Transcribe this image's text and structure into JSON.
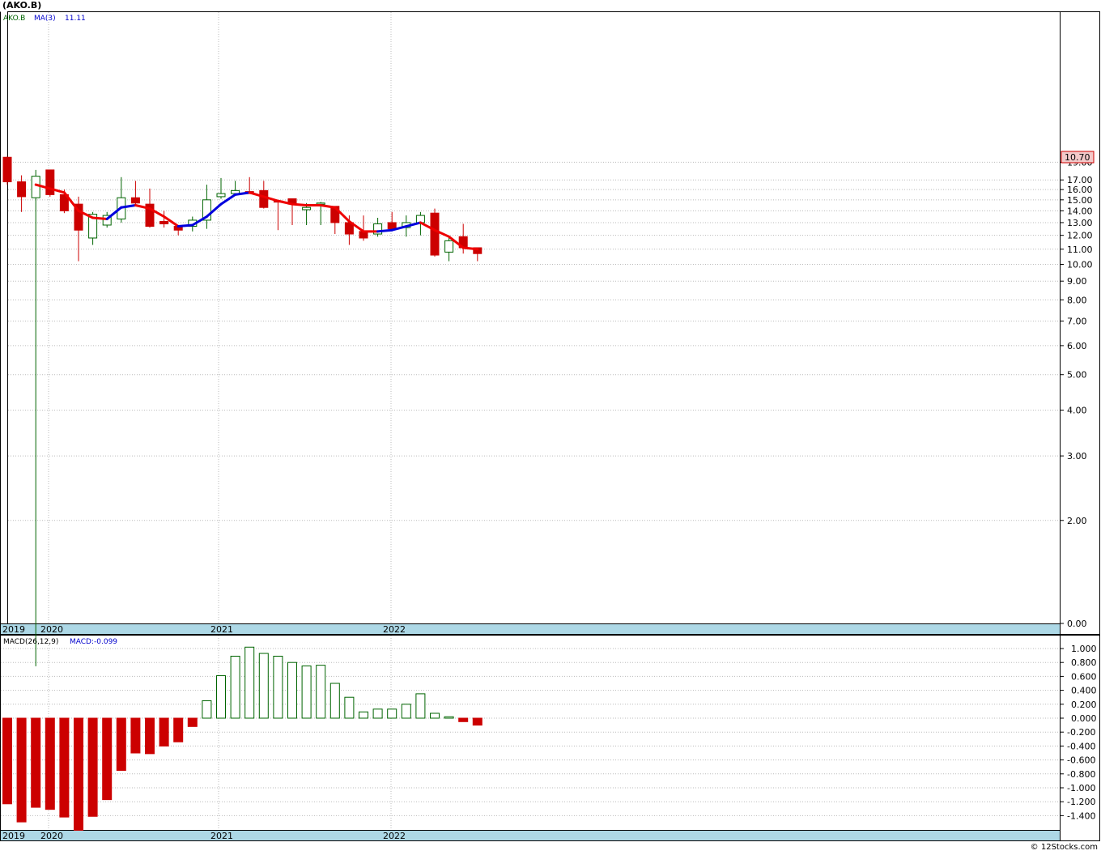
{
  "title": "(AKO.B)",
  "credit": "© 12Stocks.com",
  "chart_data": [
    {
      "type": "candlestick",
      "panel": "price",
      "legend": {
        "symbol": "AKO.B",
        "ma_label": "MA(3)",
        "ma_value": "11.11"
      },
      "last_price_label": "10.70",
      "y_scale": "log",
      "y_ticks": [
        "19.00",
        "17.00",
        "16.00",
        "15.00",
        "14.00",
        "13.00",
        "12.00",
        "11.00",
        "10.00",
        "9.00",
        "8.00",
        "7.00",
        "6.00",
        "5.00",
        "4.00",
        "3.00",
        "2.00",
        "0.00"
      ],
      "year_labels": [
        "2019",
        "2020",
        "2021",
        "2022"
      ],
      "colors": {
        "up": "#006400",
        "down": "#cc0000",
        "ma_rising": "#0000dd",
        "ma_falling": "#ee0000",
        "band": "#add8e6"
      },
      "candles": [
        {
          "o": 19.6,
          "h": 19.7,
          "l": 16.5,
          "c": 16.8
        },
        {
          "o": 16.8,
          "h": 17.5,
          "l": 13.9,
          "c": 15.3
        },
        {
          "o": 15.2,
          "h": 18.1,
          "l": 0.1,
          "c": 17.4
        },
        {
          "o": 18.1,
          "h": 18.1,
          "l": 15.3,
          "c": 15.5
        },
        {
          "o": 15.5,
          "h": 16.0,
          "l": 13.8,
          "c": 14.0
        },
        {
          "o": 14.6,
          "h": 15.3,
          "l": 10.2,
          "c": 12.4
        },
        {
          "o": 11.8,
          "h": 13.9,
          "l": 11.3,
          "c": 13.7
        },
        {
          "o": 12.8,
          "h": 13.9,
          "l": 12.6,
          "c": 13.6
        },
        {
          "o": 13.3,
          "h": 17.3,
          "l": 13.0,
          "c": 15.2
        },
        {
          "o": 15.2,
          "h": 16.9,
          "l": 14.4,
          "c": 14.7
        },
        {
          "o": 14.6,
          "h": 16.1,
          "l": 12.6,
          "c": 12.7
        },
        {
          "o": 13.1,
          "h": 14.0,
          "l": 12.6,
          "c": 12.9
        },
        {
          "o": 12.7,
          "h": 12.8,
          "l": 12.0,
          "c": 12.4
        },
        {
          "o": 12.7,
          "h": 13.5,
          "l": 12.3,
          "c": 13.2
        },
        {
          "o": 13.2,
          "h": 16.5,
          "l": 12.5,
          "c": 15.0
        },
        {
          "o": 15.3,
          "h": 17.2,
          "l": 15.1,
          "c": 15.6
        },
        {
          "o": 15.6,
          "h": 16.9,
          "l": 15.6,
          "c": 15.9
        },
        {
          "o": 15.8,
          "h": 17.3,
          "l": 15.6,
          "c": 15.6
        },
        {
          "o": 15.9,
          "h": 16.9,
          "l": 14.2,
          "c": 14.3
        },
        {
          "o": 14.9,
          "h": 15.0,
          "l": 12.4,
          "c": 14.8
        },
        {
          "o": 15.1,
          "h": 15.1,
          "l": 12.8,
          "c": 14.6
        },
        {
          "o": 14.1,
          "h": 14.7,
          "l": 12.8,
          "c": 14.3
        },
        {
          "o": 14.6,
          "h": 14.8,
          "l": 12.8,
          "c": 14.7
        },
        {
          "o": 14.4,
          "h": 14.4,
          "l": 12.1,
          "c": 13.0
        },
        {
          "o": 13.0,
          "h": 13.6,
          "l": 11.3,
          "c": 12.1
        },
        {
          "o": 12.3,
          "h": 13.6,
          "l": 11.6,
          "c": 11.8
        },
        {
          "o": 12.1,
          "h": 13.4,
          "l": 11.9,
          "c": 12.9
        },
        {
          "o": 13.0,
          "h": 13.9,
          "l": 12.6,
          "c": 12.5
        },
        {
          "o": 12.6,
          "h": 13.6,
          "l": 11.9,
          "c": 13.0
        },
        {
          "o": 13.0,
          "h": 13.9,
          "l": 12.0,
          "c": 13.6
        },
        {
          "o": 13.8,
          "h": 14.2,
          "l": 10.5,
          "c": 10.6
        },
        {
          "o": 10.8,
          "h": 11.9,
          "l": 10.2,
          "c": 11.6
        },
        {
          "o": 11.9,
          "h": 12.9,
          "l": 10.7,
          "c": 11.1
        },
        {
          "o": 11.1,
          "h": 11.1,
          "l": 10.2,
          "c": 10.7
        }
      ],
      "ma": [
        null,
        null,
        16.5,
        16.1,
        15.7,
        14.0,
        13.4,
        13.3,
        14.3,
        14.5,
        14.2,
        13.5,
        12.7,
        12.8,
        13.5,
        14.6,
        15.5,
        15.7,
        15.3,
        14.9,
        14.6,
        14.5,
        14.5,
        14.3,
        13.1,
        12.3,
        12.3,
        12.4,
        12.7,
        13.0,
        12.4,
        11.9,
        11.1,
        11.0
      ]
    },
    {
      "type": "bar",
      "panel": "macd",
      "legend": {
        "label": "MACD(26,12,9)",
        "value_label": "MACD:-0.099"
      },
      "y_ticks": [
        "1.000",
        "0.800",
        "0.600",
        "0.400",
        "0.200",
        "0.000",
        "-0.200",
        "-0.400",
        "-0.600",
        "-0.800",
        "-1.000",
        "-1.200",
        "-1.400"
      ],
      "year_labels": [
        "2019",
        "2020",
        "2021",
        "2022"
      ],
      "colors": {
        "positive": "#006400",
        "negative": "#cc0000"
      },
      "values": [
        -1.23,
        -1.49,
        -1.28,
        -1.31,
        -1.42,
        -1.61,
        -1.41,
        -1.17,
        -0.75,
        -0.5,
        -0.51,
        -0.4,
        -0.34,
        -0.12,
        0.25,
        0.61,
        0.89,
        1.02,
        0.93,
        0.89,
        0.8,
        0.75,
        0.76,
        0.5,
        0.3,
        0.09,
        0.13,
        0.13,
        0.2,
        0.35,
        0.07,
        0.02,
        -0.05,
        -0.1
      ]
    }
  ]
}
